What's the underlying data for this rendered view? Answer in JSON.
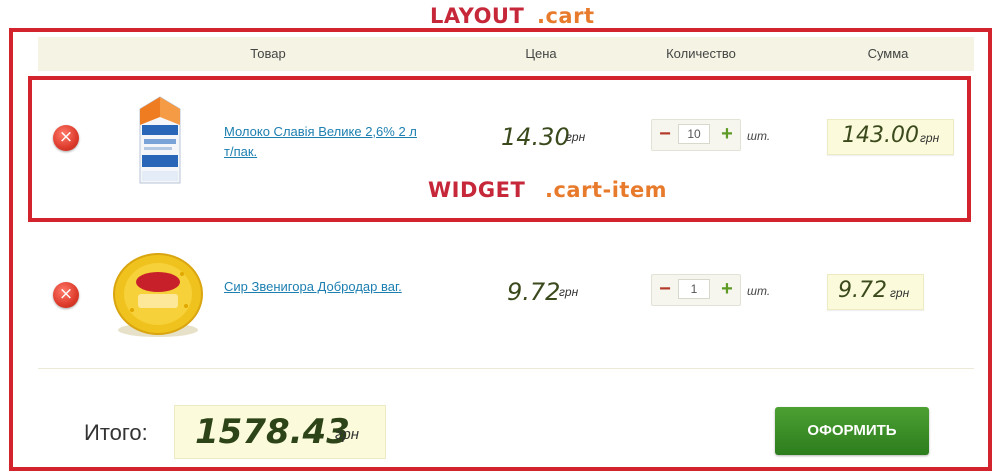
{
  "annotations": {
    "layout_word": "LAYOUT",
    "layout_class": ".cart",
    "widget_word": "WIDGET",
    "widget_class": ".cart-item",
    "frame_color": "#d3232d"
  },
  "table": {
    "headers": {
      "product": "Товар",
      "price": "Цена",
      "quantity": "Количество",
      "sum": "Сумма"
    }
  },
  "items": [
    {
      "name": "Молоко Славія Велике 2,6% 2 л т/пак.",
      "image_icon": "milk-carton-icon",
      "price": "14.30",
      "currency": "грн",
      "quantity": "10",
      "unit": "шт.",
      "sum": "143.00",
      "minus": "−",
      "plus": "+",
      "remove": "×"
    },
    {
      "name": "Сир Звенигора Добродар ваг.",
      "image_icon": "cheese-wheel-icon",
      "price": "9.72",
      "currency": "грн",
      "quantity": "1",
      "unit": "шт.",
      "sum": "9.72",
      "minus": "−",
      "plus": "+",
      "remove": "×"
    }
  ],
  "totals": {
    "label": "Итого:",
    "value": "1578.43",
    "currency": "грн"
  },
  "checkout": {
    "label": "ОФОРМИТЬ",
    "color": "#3a8f28"
  },
  "colors": {
    "header_bg": "#f5f4e4",
    "link": "#1c7fb0",
    "price": "#3b4a1c"
  }
}
